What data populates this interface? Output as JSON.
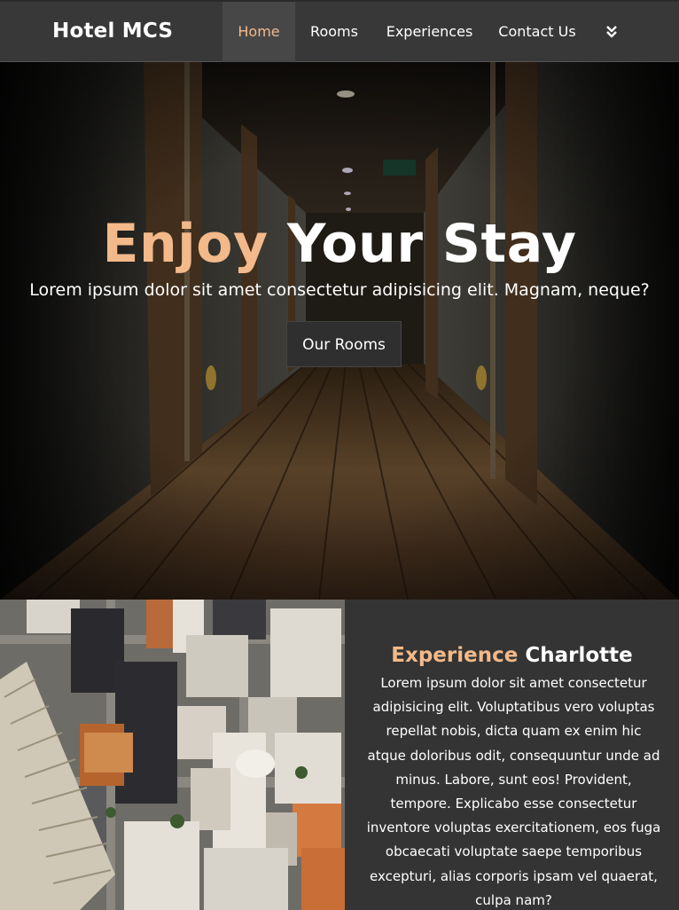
{
  "navbar": {
    "brand": "Hotel MCS",
    "items": [
      {
        "label": "Home",
        "active": true
      },
      {
        "label": "Rooms",
        "active": false
      },
      {
        "label": "Experiences",
        "active": false
      },
      {
        "label": "Contact Us",
        "active": false
      }
    ],
    "more_icon": "double-chevron-down-icon"
  },
  "hero": {
    "title_accent": "Enjoy",
    "title_rest": "Your Stay",
    "subtitle": "Lorem ipsum dolor sit amet consectetur adipisicing elit. Magnam, neque?",
    "button_label": "Our Rooms"
  },
  "experience": {
    "title_accent": "Experience",
    "title_rest": "Charlotte",
    "body": "Lorem ipsum dolor sit amet consectetur adipisicing elit. Voluptatibus vero voluptas repellat nobis, dicta quam ex enim hic atque doloribus odit, consequuntur unde ad minus. Labore, sunt eos! Provident, tempore. Explicabo esse consectetur inventore voluptas exercitationem, eos fuga obcaecati voluptate saepe temporibus excepturi, alias corporis ipsam vel quaerat, culpa nam?"
  },
  "colors": {
    "accent": "#f3b98a",
    "nav_bg": "#383838",
    "panel_bg": "#343434"
  }
}
